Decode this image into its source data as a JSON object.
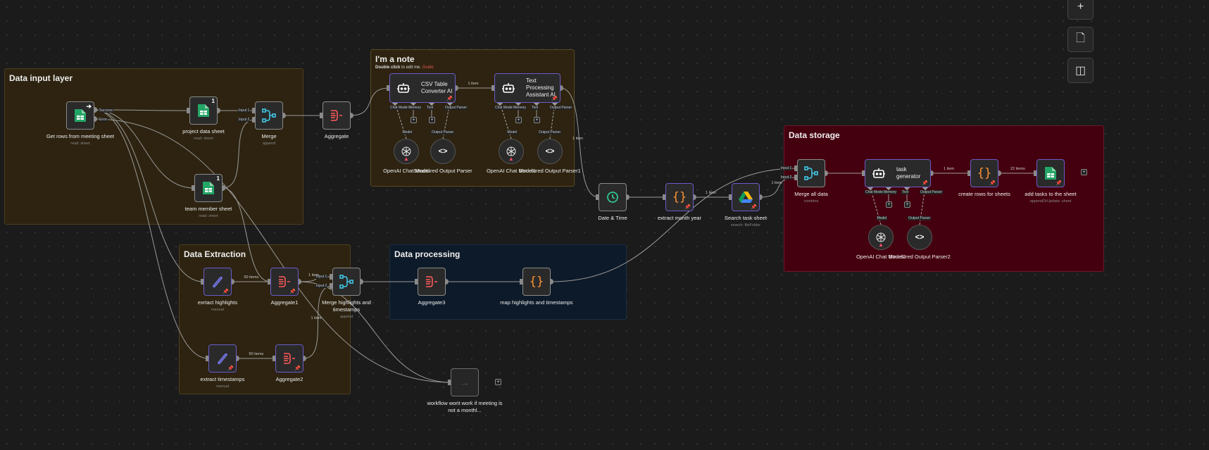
{
  "groups": [
    {
      "title": "Data input layer",
      "bg": "#2d2310",
      "border": "#4d3f1e"
    },
    {
      "title": "I'm a note",
      "subtitle_bold": "Double click",
      "subtitle_rest": " to edit me. ",
      "link": "Guide",
      "bg": "#2d2310",
      "border": "#5b4a20"
    },
    {
      "title": "Data storage",
      "bg": "#45000f",
      "border": "#6a1a28"
    },
    {
      "title": "Data Extraction",
      "bg": "#2d2310",
      "border": "#4d3f1e"
    },
    {
      "title": "Data processing",
      "bg": "#0d1a29",
      "border": "#1d2d42"
    }
  ],
  "nodes": [
    {
      "label": "Get rows from meeting sheet",
      "sub": "read: sheet",
      "icon": "sheets",
      "trigger": true,
      "outs": [
        "Success",
        "Error"
      ]
    },
    {
      "label": "project data sheet",
      "sub": "read: sheet",
      "icon": "sheets",
      "badge": "1"
    },
    {
      "label": "team member sheet",
      "sub": "read: sheet",
      "icon": "sheets",
      "badge": "1"
    },
    {
      "label": "Merge",
      "sub": "append",
      "icon": "merge",
      "ins": [
        "Input 1",
        "Input 2"
      ]
    },
    {
      "label": "Aggregate",
      "icon": "aggregate"
    },
    {
      "label": "CSV Table Converter AI",
      "icon": "robot",
      "wide": true,
      "pin": true,
      "subs": [
        "Chat Model",
        "Memory",
        "Tool",
        "Output Parser"
      ]
    },
    {
      "label": "Text Processing Assistant AI",
      "icon": "robot",
      "wide": true,
      "pin": true,
      "subs": [
        "Chat Model",
        "Memory",
        "Tool",
        "Output Parser"
      ]
    },
    {
      "label": "OpenAI Chat Model",
      "icon": "openai",
      "circle": true,
      "top": "Model",
      "warn": true
    },
    {
      "label": "Structured Output Parser",
      "icon": "code",
      "circle": true,
      "top": "Output Parser"
    },
    {
      "label": "OpenAI Chat Model1",
      "icon": "openai",
      "circle": true,
      "top": "Model",
      "warn": true
    },
    {
      "label": "Structured Output Parser1",
      "icon": "code",
      "circle": true,
      "top": "Output Parser"
    },
    {
      "label": "Date & Time",
      "icon": "clock"
    },
    {
      "label": "extract month year",
      "icon": "braces",
      "pin": true
    },
    {
      "label": "Search task sheet",
      "sub": "search: fileFolder",
      "icon": "drive",
      "pin": true
    },
    {
      "label": "Merge all data",
      "sub": "combine",
      "icon": "merge",
      "ins": [
        "Input 1",
        "Input 2"
      ]
    },
    {
      "label": "task generator",
      "icon": "robot",
      "wide": true,
      "pin": true,
      "subs": [
        "Chat Model",
        "Memory",
        "Tool",
        "Output Parser"
      ]
    },
    {
      "label": "OpenAI Chat Model2",
      "icon": "openai",
      "circle": true,
      "top": "Model",
      "warn": true
    },
    {
      "label": "Structured Output Parser2",
      "icon": "code",
      "circle": true,
      "top": "Output Parser"
    },
    {
      "label": "create rows for sheets",
      "icon": "braces",
      "pin": true
    },
    {
      "label": "add tasks to the sheet",
      "sub": "appendOrUpdate: sheet",
      "icon": "sheets",
      "pin": true
    },
    {
      "label": "exrtact highlights",
      "sub": "manual",
      "icon": "pen",
      "pin": true
    },
    {
      "label": "Aggregate1",
      "icon": "aggregate",
      "pin": true
    },
    {
      "label": "Merge highlights and timestamps",
      "sub": "append",
      "icon": "merge",
      "ins": [
        "Input 1",
        "Input 2"
      ]
    },
    {
      "label": "Aggregate3",
      "icon": "aggregate"
    },
    {
      "label": "map highlights and timestamps",
      "icon": "braces"
    },
    {
      "label": "extract timestamps",
      "sub": "manual",
      "icon": "pen",
      "pin": true
    },
    {
      "label": "Aggregate2",
      "icon": "aggregate",
      "pin": true
    },
    {
      "label": "workflow wont work if meeting is not a monthl...",
      "icon": "arrow",
      "disabled": true
    }
  ],
  "edges": [
    {
      "from": 0,
      "to": 1
    },
    {
      "from": 0,
      "to": 2
    },
    {
      "from": 0,
      "to": 20
    },
    {
      "from": 0,
      "to": 25
    },
    {
      "from": 0,
      "to": 27,
      "port": 1
    },
    {
      "from": 1,
      "to": 3
    },
    {
      "from": 2,
      "to": 3,
      "in": 1
    },
    {
      "from": 2,
      "to": 21
    },
    {
      "from": 3,
      "to": 4
    },
    {
      "from": 4,
      "to": 5
    },
    {
      "from": 5,
      "to": 6,
      "label": "1 item"
    },
    {
      "from": 6,
      "to": 11,
      "label": "1 item"
    },
    {
      "from": 11,
      "to": 12
    },
    {
      "from": 12,
      "to": 13,
      "label": "1 item"
    },
    {
      "from": 13,
      "to": 14,
      "in": 1,
      "label": "1 item"
    },
    {
      "from": 20,
      "to": 21,
      "label": "50 items"
    },
    {
      "from": 21,
      "to": 22,
      "label": "1 item"
    },
    {
      "from": 25,
      "to": 26,
      "label": "50 items"
    },
    {
      "from": 26,
      "to": 22,
      "in": 1,
      "label": "1 item"
    },
    {
      "from": 22,
      "to": 23
    },
    {
      "from": 23,
      "to": 24
    },
    {
      "from": 24,
      "to": 14
    },
    {
      "from": 21,
      "to": 27
    },
    {
      "from": 14,
      "to": 15
    },
    {
      "from": 15,
      "to": 18,
      "label": "1 item"
    },
    {
      "from": 18,
      "to": 19,
      "label": "22 items"
    }
  ],
  "sublinks": [
    {
      "from": 7,
      "to": 5,
      "slot": 0
    },
    {
      "from": 8,
      "to": 5,
      "slot": 3
    },
    {
      "from": 9,
      "to": 6,
      "slot": 0
    },
    {
      "from": 10,
      "to": 6,
      "slot": 3
    },
    {
      "from": 16,
      "to": 15,
      "slot": 0
    },
    {
      "from": 17,
      "to": 15,
      "slot": 3
    }
  ],
  "toolbar": [
    {
      "name": "add-node-button",
      "glyph": "+"
    },
    {
      "name": "sticky-note-button",
      "glyph": "🗋"
    },
    {
      "name": "toggle-panel-button",
      "glyph": "◫"
    }
  ],
  "colors": {
    "pinned": "#6a5bc7",
    "aggregate": "#ff5a5a",
    "merge": "#3fb6d1",
    "code": "#ff9233",
    "sheets": "#23a566"
  }
}
